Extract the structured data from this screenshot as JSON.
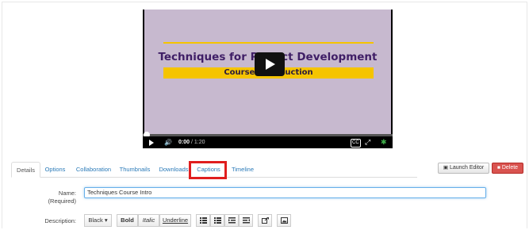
{
  "video": {
    "slide_title": "Techniques for Project Development",
    "slide_subtitle": "Course Introduction",
    "current_time": "0:00",
    "duration": "/ 1:20",
    "progress": 0,
    "cc_label": "CC"
  },
  "tabs": [
    "Details",
    "Options",
    "Collaboration",
    "Thumbnails",
    "Downloads",
    "Captions",
    "Timeline"
  ],
  "active_tab": "Details",
  "highlighted_tab": "Captions",
  "buttons": {
    "launch_editor": "Launch Editor",
    "delete": "Delete"
  },
  "form": {
    "name_label": "Name:",
    "name_required": "(Required)",
    "name_value": "Techniques Course Intro",
    "description_label": "Description:"
  },
  "toolbar": {
    "color": "Black",
    "bold": "Bold",
    "italic": "Italic",
    "underline": "Underline"
  },
  "colors": {
    "highlight": "#e01e1e",
    "delete": "#d9534f",
    "link": "#2a7ab8",
    "slide_bg": "#c7b9cf",
    "slide_accent": "#f5c400"
  }
}
